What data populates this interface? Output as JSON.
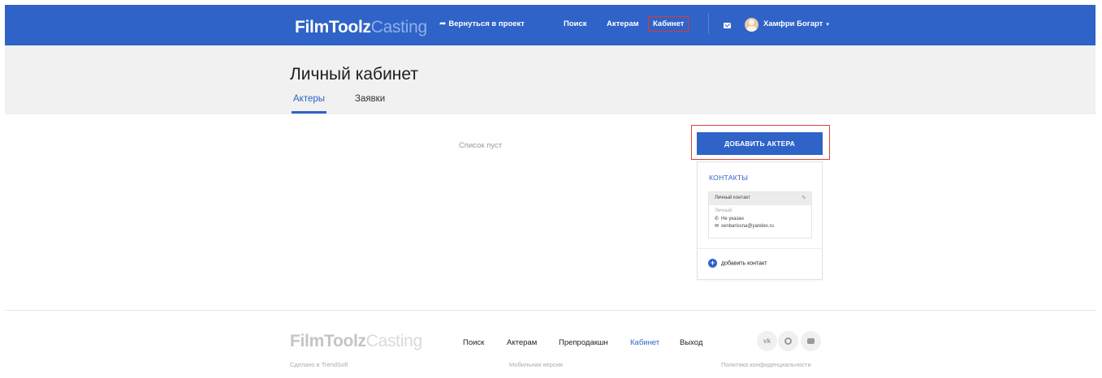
{
  "header": {
    "logo_bold": "FilmToolz",
    "logo_light": "Casting",
    "nav": {
      "back": "Вернуться в проект",
      "search": "Поиск",
      "actors": "Актерам",
      "cabinet": "Кабинет"
    },
    "user_name": "Хамфри Богарт"
  },
  "page": {
    "title": "Личный кабинет",
    "tabs": [
      {
        "label": "Актеры",
        "active": true
      },
      {
        "label": "Заявки",
        "active": false
      }
    ]
  },
  "main": {
    "empty_text": "Список пуст",
    "add_actor_label": "ДОБАВИТЬ АКТЕРА"
  },
  "contacts": {
    "title": "КОНТАКТЫ",
    "card_label": "Личный контакт",
    "type": "Личный",
    "phone": "Не указан",
    "email": "xenbarissna@yandex.ru",
    "add_contact_label": "добавить контакт"
  },
  "footer": {
    "logo_bold": "FilmToolz",
    "logo_light": "Casting",
    "links": {
      "search": "Поиск",
      "actors": "Актерам",
      "production": "Препродакшн",
      "cabinet": "Кабинет",
      "exit": "Выход"
    },
    "social": {
      "vk": "vk"
    },
    "made_by": "Сделано в TrendSoft",
    "mobile": "Мобильная версия",
    "privacy": "Политика конфиденциальности"
  },
  "colors": {
    "primary": "#2f63c7",
    "highlight_border": "#d9403a",
    "band": "#f1f1f1"
  }
}
